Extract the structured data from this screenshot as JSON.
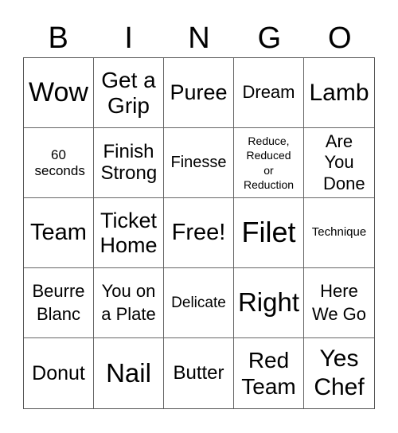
{
  "header": {
    "letters": [
      "B",
      "I",
      "N",
      "G",
      "O"
    ]
  },
  "board": {
    "rows": [
      [
        "Wow",
        "Get a Grip",
        "Puree",
        "Dream",
        "Lamb"
      ],
      [
        "60 seconds",
        "Finish Strong",
        "Finesse",
        "Reduce, Reduced or Reduction",
        "Are You Done"
      ],
      [
        "Team",
        "Ticket Home",
        "Free!",
        "Filet",
        "Technique"
      ],
      [
        "Beurre Blanc",
        "You on a Plate",
        "Delicate",
        "Right",
        "Here We Go"
      ],
      [
        "Donut",
        "Nail",
        "Butter",
        "Red Team",
        "Yes Chef"
      ]
    ]
  }
}
